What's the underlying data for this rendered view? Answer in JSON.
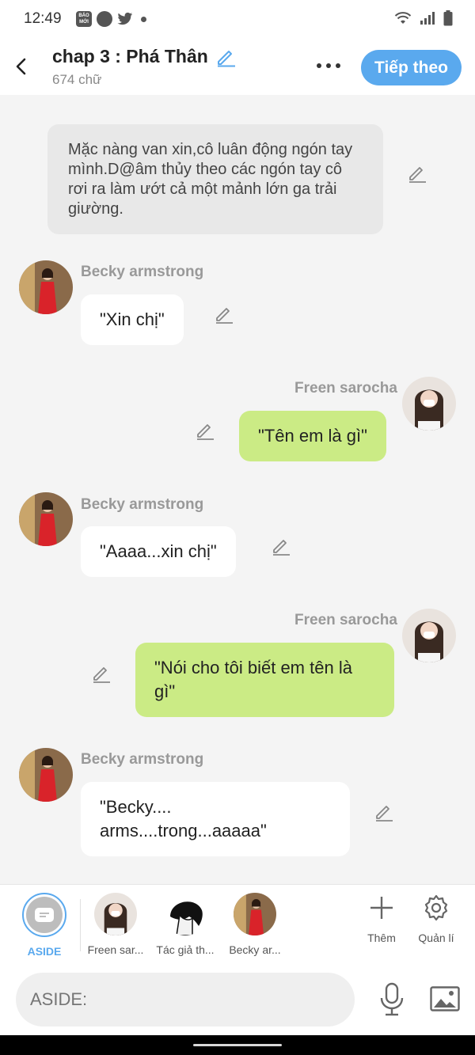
{
  "status_bar": {
    "time": "12:49",
    "badge_text": "BÁO MỚI"
  },
  "header": {
    "title": "chap 3 : Phá Thân",
    "word_count": "674 chữ",
    "next_button": "Tiếp theo"
  },
  "narration": {
    "text": "Mặc nàng van xin,cô luân động ngón tay mình.D@âm thủy theo các ngón tay cô rơi ra làm ướt cả một mảnh lớn ga trải giường."
  },
  "messages": [
    {
      "sender": "Becky armstrong",
      "text": "\"Xin chị\"",
      "side": "left"
    },
    {
      "sender": "Freen sarocha",
      "text": "\"Tên em là gì\"",
      "side": "right"
    },
    {
      "sender": "Becky armstrong",
      "text": "\"Aaaa...xin chị\"",
      "side": "left"
    },
    {
      "sender": "Freen sarocha",
      "text": "\"Nói cho tôi biết em tên là gì\"",
      "side": "right"
    },
    {
      "sender": "Becky armstrong",
      "text": "\"Becky.... arms....trong...aaaaa\"",
      "side": "left"
    }
  ],
  "characters": [
    {
      "label": "ASIDE",
      "selected": true
    },
    {
      "label": "Freen sar..."
    },
    {
      "label": "Tác giả th..."
    },
    {
      "label": "Becky ar..."
    }
  ],
  "tools": {
    "add_label": "Thêm",
    "manage_label": "Quản lí"
  },
  "composer": {
    "placeholder": "ASIDE:"
  },
  "colors": {
    "accent": "#5aa9ee",
    "right_bubble": "#cbeb85",
    "left_bubble": "#ffffff",
    "narration_bg": "#e8e8e8"
  }
}
